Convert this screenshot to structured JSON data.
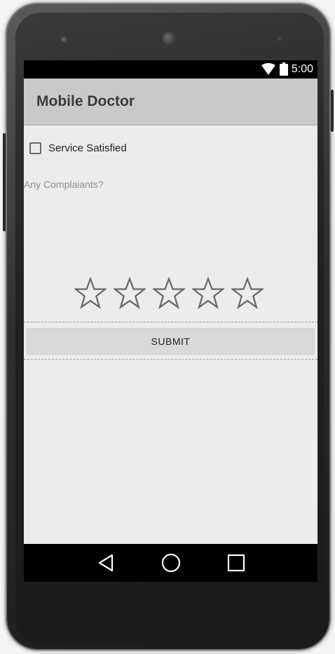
{
  "status_bar": {
    "time": "5:00",
    "icons": [
      "wifi-icon",
      "battery-icon"
    ]
  },
  "app_bar": {
    "title": "Mobile Doctor",
    "background": "#c9c9c9"
  },
  "form": {
    "service_checkbox": {
      "label": "Service Satisfied",
      "checked": false
    },
    "complaints": {
      "placeholder": "Any Complaiants?",
      "value": ""
    },
    "rating": {
      "max_stars": 5,
      "value": 0
    },
    "submit_label": "SUBMIT"
  },
  "nav_bar": {
    "buttons": [
      "back-icon",
      "home-icon",
      "recents-icon"
    ]
  }
}
